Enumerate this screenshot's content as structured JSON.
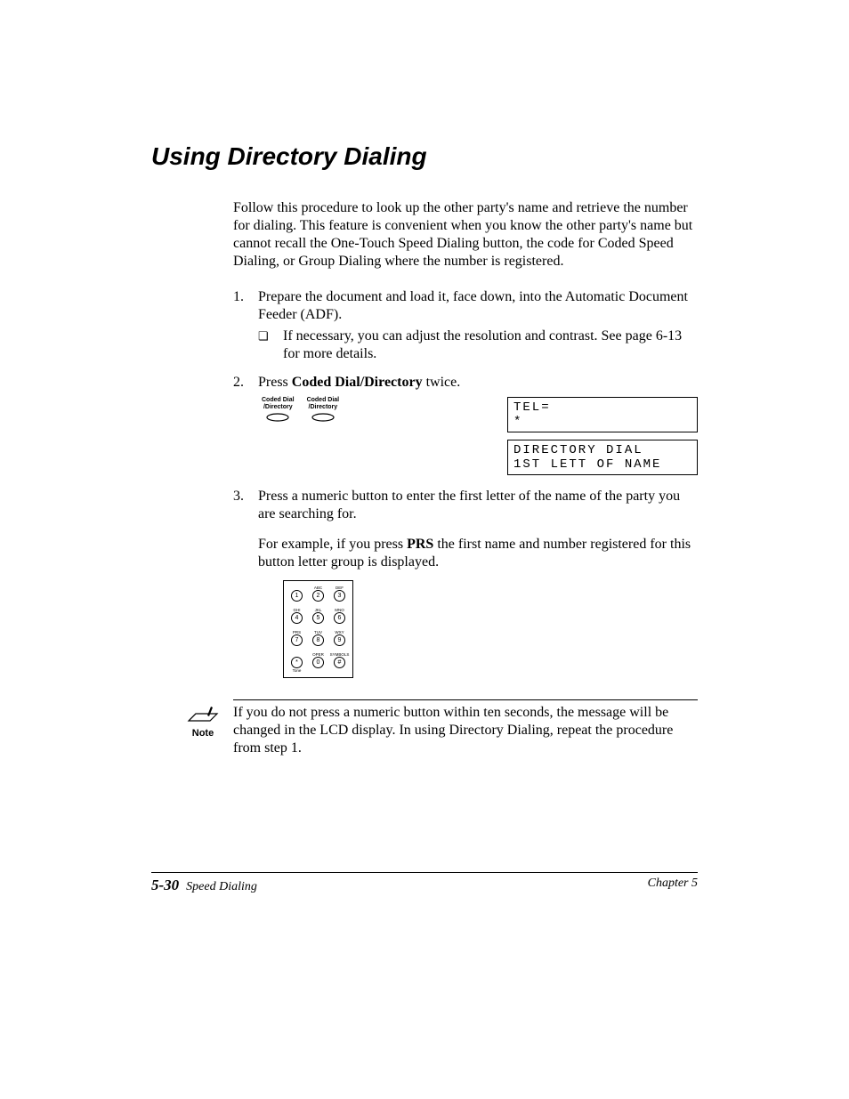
{
  "heading": "Using Directory Dialing",
  "intro": "Follow this procedure to look up the other party's name and retrieve the number for dialing. This feature is convenient when you know the other party's name but cannot recall the One-Touch Speed Dialing button, the code for Coded Speed Dialing, or Group Dialing where the number is registered.",
  "steps": {
    "s1": {
      "num": "1.",
      "text": "Prepare the document and load it, face down, into the Automatic Document Feeder (ADF).",
      "sub_bullet": "❏",
      "sub_text": "If necessary, you can adjust the resolution and contrast. See page 6-13 for more details."
    },
    "s2": {
      "num": "2.",
      "text_a": "Press ",
      "text_bold": "Coded Dial/Directory",
      "text_b": " twice.",
      "btn_label_a": "Coded Dial",
      "btn_label_b": "/Directory",
      "lcd1_a": "TEL=",
      "lcd1_b": "*",
      "lcd2_a": "DIRECTORY DIAL",
      "lcd2_b": "1ST LETT OF NAME"
    },
    "s3": {
      "num": "3.",
      "text": "Press a numeric button to enter the first letter of the name of the party you are searching for.",
      "example_a": "For example, if you press ",
      "example_bold": "PRS",
      "example_b": " the first name and number registered for this button letter group is displayed."
    }
  },
  "keypad": {
    "rows": [
      [
        {
          "top": "",
          "num": "1",
          "bot": ""
        },
        {
          "top": "ABC",
          "num": "2",
          "bot": ""
        },
        {
          "top": "DEF",
          "num": "3",
          "bot": ""
        }
      ],
      [
        {
          "top": "GHI",
          "num": "4",
          "bot": ""
        },
        {
          "top": "JKL",
          "num": "5",
          "bot": ""
        },
        {
          "top": "MNO",
          "num": "6",
          "bot": ""
        }
      ],
      [
        {
          "top": "PRS",
          "num": "7",
          "bot": ""
        },
        {
          "top": "TUV",
          "num": "8",
          "bot": ""
        },
        {
          "top": "WXY",
          "num": "9",
          "bot": ""
        }
      ],
      [
        {
          "top": "",
          "num": "*",
          "bot": "Tone"
        },
        {
          "top": "OPER",
          "num": "0",
          "bot": ""
        },
        {
          "top": "SYMBOLS",
          "num": "#",
          "bot": ""
        }
      ]
    ]
  },
  "note": {
    "label": "Note",
    "text": "If you do not press a numeric button within ten seconds, the message will be changed in the LCD display. In using Directory Dialing, repeat the procedure from step 1."
  },
  "footer": {
    "page": "5-30",
    "section": "Speed Dialing",
    "chapter": "Chapter 5"
  }
}
